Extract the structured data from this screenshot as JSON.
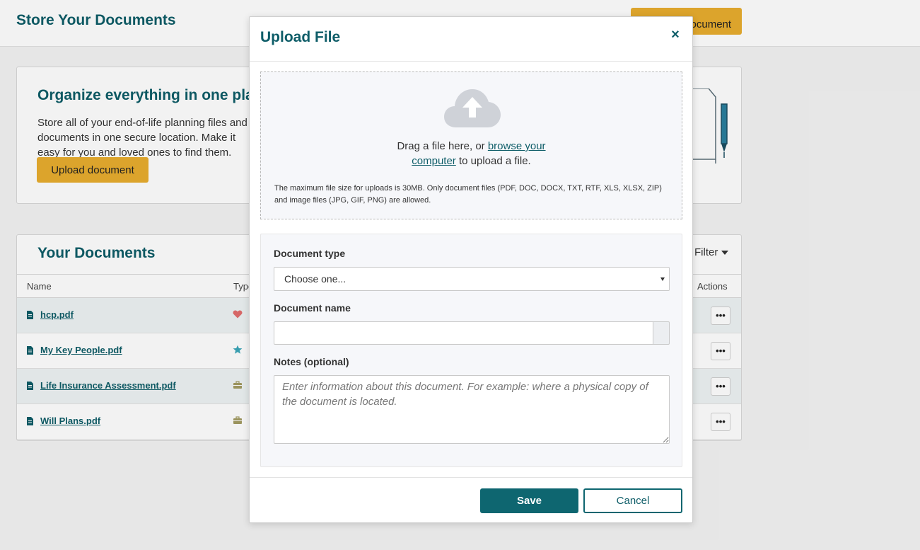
{
  "page": {
    "title": "Store Your Documents",
    "top_button_label": "Upload Document"
  },
  "promo": {
    "heading": "Organize everything in one place",
    "text": "Store all of your end-of-life planning files and documents in one secure location. Make it easy for you and loved ones to find them.",
    "button_label": "Upload document"
  },
  "documents": {
    "heading": "Your Documents",
    "filter_label": "Filter",
    "columns": {
      "name": "Name",
      "type": "Type",
      "actions": "Actions"
    },
    "rows": [
      {
        "name": "hcp.pdf",
        "type_icon": "heart-icon",
        "actions_label": "•••"
      },
      {
        "name": "My Key People.pdf",
        "type_icon": "star-icon",
        "actions_label": "•••"
      },
      {
        "name": "Life Insurance Assessment.pdf",
        "type_icon": "briefcase-icon",
        "actions_label": "•••"
      },
      {
        "name": "Will Plans.pdf",
        "type_icon": "briefcase-icon",
        "actions_label": "•••"
      }
    ]
  },
  "modal": {
    "title": "Upload File",
    "close_label": "×",
    "dropzone": {
      "text_before": "Drag a file here, or ",
      "link_part1": "browse your",
      "link_part2": "computer",
      "text_after": " to upload a file.",
      "note": "The maximum file size for uploads is 30MB. Only document files (PDF, DOC, DOCX, TXT, RTF, XLS, XLSX, ZIP) and image files (JPG, GIF, PNG) are allowed."
    },
    "form": {
      "type_label": "Document type",
      "type_value": "Choose one...",
      "name_label": "Document name",
      "name_value": "",
      "notes_label": "Notes (optional)",
      "notes_placeholder": "Enter information about this document. For example: where a physical copy of the document is located."
    },
    "save_label": "Save",
    "cancel_label": "Cancel"
  },
  "colors": {
    "brand": "#0e5d68",
    "accent": "#e8ad2f",
    "heart": "#e26d6d",
    "star": "#3aa6b9",
    "briefcase": "#a39b62"
  }
}
